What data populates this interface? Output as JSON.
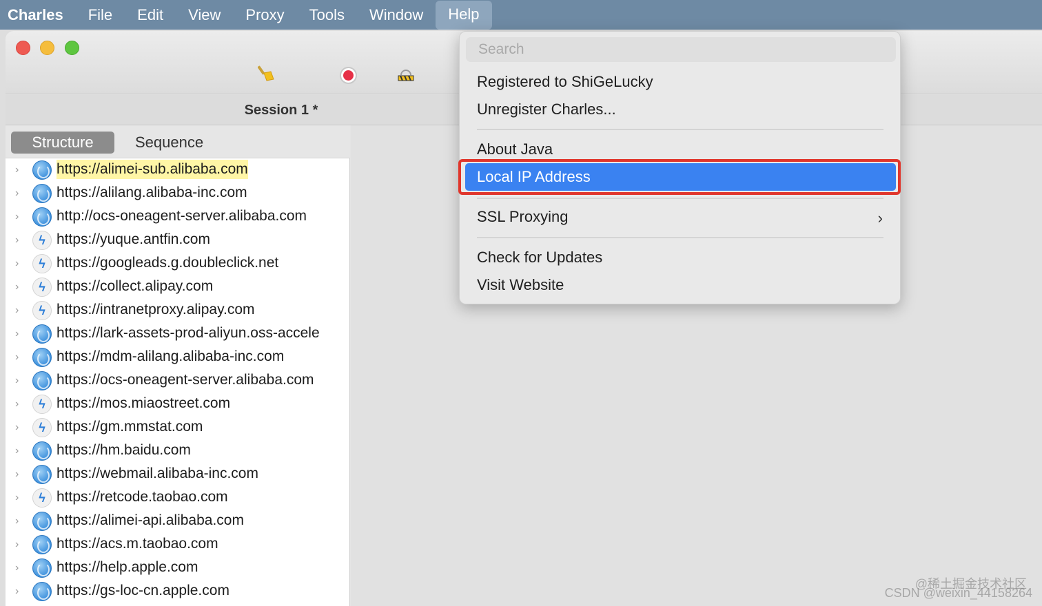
{
  "menubar": {
    "app": "Charles",
    "items": [
      "File",
      "Edit",
      "View",
      "Proxy",
      "Tools",
      "Window",
      "Help"
    ]
  },
  "session": {
    "tab_label": "Session 1 *",
    "right_fragment": ")"
  },
  "view_tabs": {
    "structure": "Structure",
    "sequence": "Sequence"
  },
  "hosts": [
    {
      "url": "https://alimei-sub.alibaba.com",
      "icon": "globe-icon",
      "highlighted": true
    },
    {
      "url": "https://alilang.alibaba-inc.com",
      "icon": "globe-icon"
    },
    {
      "url": "http://ocs-oneagent-server.alibaba.com",
      "icon": "globe-icon"
    },
    {
      "url": "https://yuque.antfin.com",
      "icon": "bolt-icon"
    },
    {
      "url": "https://googleads.g.doubleclick.net",
      "icon": "bolt-icon"
    },
    {
      "url": "https://collect.alipay.com",
      "icon": "bolt-icon"
    },
    {
      "url": "https://intranetproxy.alipay.com",
      "icon": "bolt-icon"
    },
    {
      "url": "https://lark-assets-prod-aliyun.oss-accele",
      "icon": "globe-icon"
    },
    {
      "url": "https://mdm-alilang.alibaba-inc.com",
      "icon": "globe-icon"
    },
    {
      "url": "https://ocs-oneagent-server.alibaba.com",
      "icon": "globe-icon"
    },
    {
      "url": "https://mos.miaostreet.com",
      "icon": "bolt-icon"
    },
    {
      "url": "https://gm.mmstat.com",
      "icon": "bolt-icon"
    },
    {
      "url": "https://hm.baidu.com",
      "icon": "globe-icon"
    },
    {
      "url": "https://webmail.alibaba-inc.com",
      "icon": "globe-icon"
    },
    {
      "url": "https://retcode.taobao.com",
      "icon": "bolt-icon"
    },
    {
      "url": "https://alimei-api.alibaba.com",
      "icon": "globe-icon"
    },
    {
      "url": "https://acs.m.taobao.com",
      "icon": "globe-icon"
    },
    {
      "url": "https://help.apple.com",
      "icon": "globe-icon"
    },
    {
      "url": "https://gs-loc-cn.apple.com",
      "icon": "globe-icon"
    }
  ],
  "help_menu": {
    "search_placeholder": "Search",
    "registered": "Registered to ShiGeLucky",
    "unregister": "Unregister Charles...",
    "about_java": "About Java",
    "local_ip": "Local IP Address",
    "ssl_proxying": "SSL Proxying",
    "check_updates": "Check for Updates",
    "visit_website": "Visit Website"
  },
  "watermark": {
    "line1": "@稀土掘金技术社区",
    "line2": "CSDN @weixin_44158264"
  },
  "colors": {
    "menubar": "#6e8aa4",
    "highlight": "#3a82f1",
    "annotation": "#e0362c",
    "host_highlight": "#fff6a6"
  }
}
